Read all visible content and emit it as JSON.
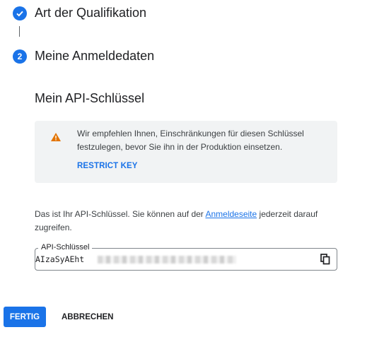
{
  "steps": [
    {
      "icon": "check-icon",
      "title": "Art der Qualifikation"
    },
    {
      "number": "2",
      "title": "Meine Anmeldedaten"
    }
  ],
  "section_title": "Mein API-Schlüssel",
  "warning": {
    "icon": "warning-triangle-icon",
    "text": "Wir empfehlen Ihnen, Einschränkungen für diesen Schlüssel festzulegen, bevor Sie ihn in der Produktion einsetzen.",
    "link": "RESTRICT KEY"
  },
  "info": {
    "before": "Das ist Ihr API-Schlüssel. Sie können auf der ",
    "link": "Anmeldeseite",
    "after": " jederzeit darauf zugreifen."
  },
  "key_field": {
    "label": "API-Schlüssel",
    "value_visible": "AIzaSyAEht",
    "copy_icon": "copy-icon"
  },
  "buttons": {
    "done": "FERTIG",
    "cancel": "ABBRECHEN"
  },
  "colors": {
    "accent": "#1a73e8",
    "warning": "#e37400",
    "box_bg": "#f1f3f4"
  }
}
